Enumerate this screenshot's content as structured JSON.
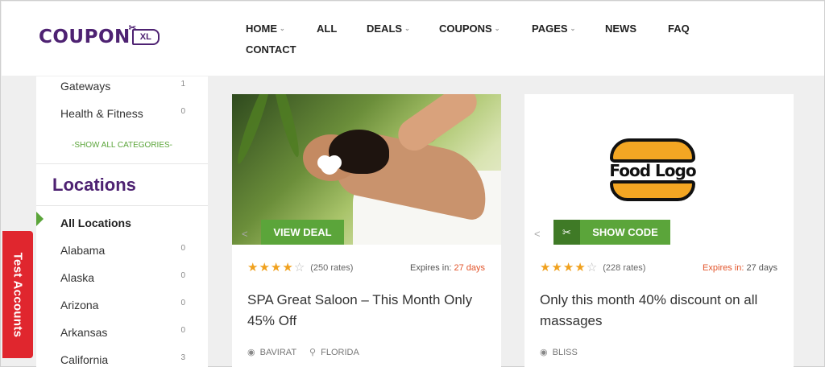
{
  "header": {
    "logo_text": "COUPON",
    "logo_tag": "XL",
    "nav": [
      {
        "label": "HOME",
        "dropdown": true
      },
      {
        "label": "ALL",
        "dropdown": false
      },
      {
        "label": "DEALS",
        "dropdown": true
      },
      {
        "label": "COUPONS",
        "dropdown": true
      },
      {
        "label": "PAGES",
        "dropdown": true
      },
      {
        "label": "NEWS",
        "dropdown": false
      },
      {
        "label": "FAQ",
        "dropdown": false
      },
      {
        "label": "CONTACT",
        "dropdown": false
      }
    ]
  },
  "sidebar": {
    "categories": [
      {
        "label": "Gateways",
        "count": "1"
      },
      {
        "label": "Health & Fitness",
        "count": "0"
      }
    ],
    "show_all": "-SHOW ALL CATEGORIES-",
    "locations_title": "Locations",
    "locations": [
      {
        "label": "All Locations",
        "count": ""
      },
      {
        "label": "Alabama",
        "count": "0"
      },
      {
        "label": "Alaska",
        "count": "0"
      },
      {
        "label": "Arizona",
        "count": "0"
      },
      {
        "label": "Arkansas",
        "count": "0"
      },
      {
        "label": "California",
        "count": "3"
      }
    ]
  },
  "test_tab": "Test Accounts",
  "cards": [
    {
      "button": "VIEW DEAL",
      "stars": 4,
      "rates": "(250 rates)",
      "expires_label": "Expires in:",
      "expires_days": "27 days",
      "title": "SPA Great Saloon – This Month Only 45% Off",
      "store": "BAVIRAT",
      "location": "FLORIDA"
    },
    {
      "logo_text": "Food Logo",
      "button": "SHOW CODE",
      "stars": 4,
      "rates": "(228 rates)",
      "expires_label": "Expires in:",
      "expires_days": "27 days",
      "title": "Only this month 40% discount on all massages",
      "store": "BLISS"
    }
  ],
  "colors": {
    "brand_purple": "#4e2272",
    "accent_green": "#5ba53a",
    "star": "#f0a11e",
    "expire_red": "#e2542a",
    "test_tab": "#e0262e"
  }
}
